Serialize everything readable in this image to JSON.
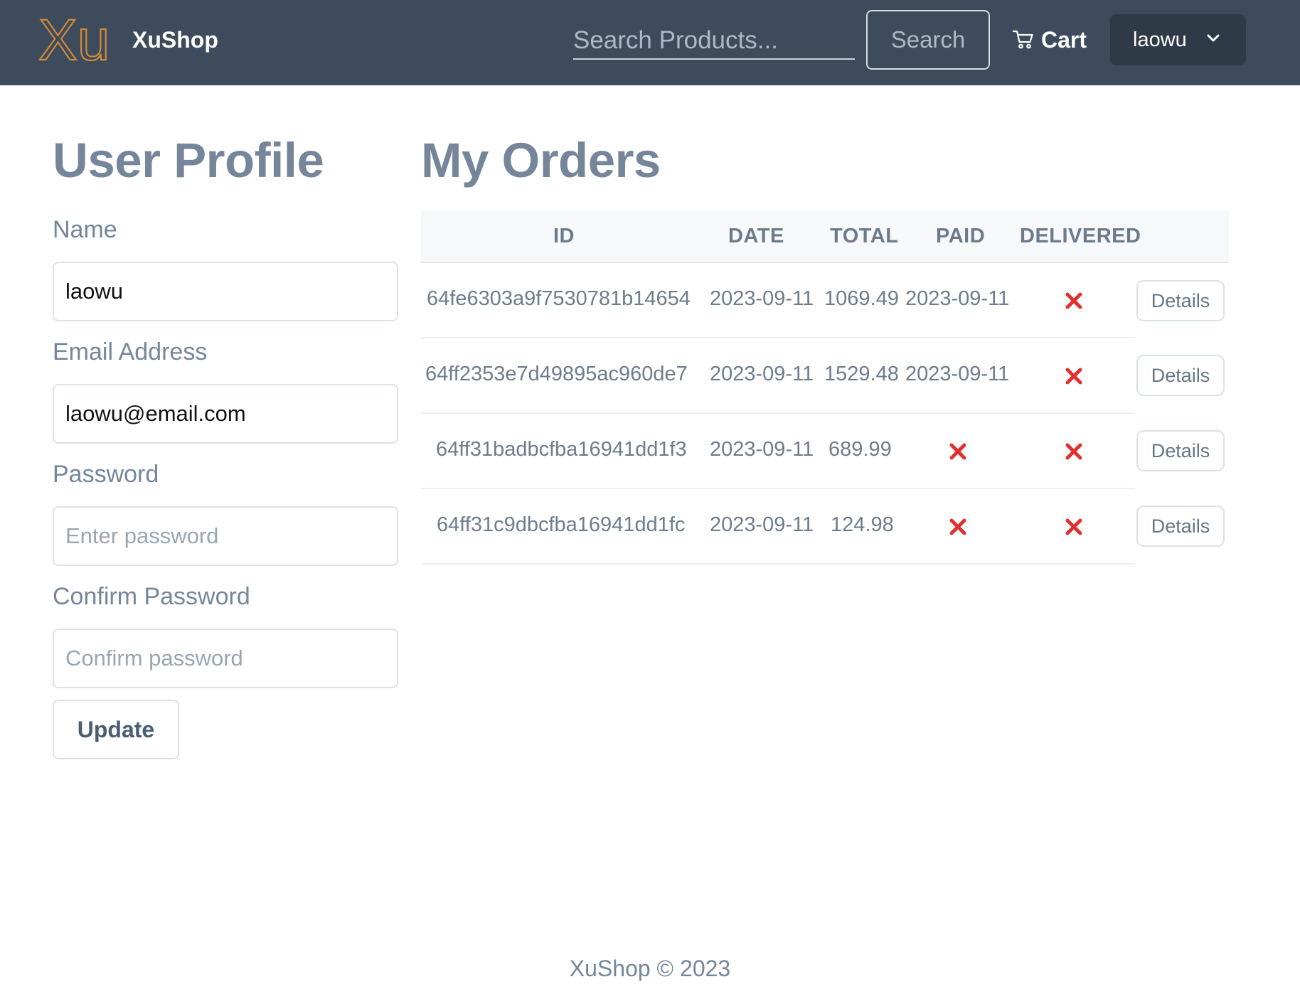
{
  "navbar": {
    "logo_text": "Xu",
    "brand": "XuShop",
    "search_placeholder": "Search Products...",
    "search_button": "Search",
    "cart_label": "Cart",
    "user_menu": "laowu"
  },
  "profile": {
    "title": "User Profile",
    "name_label": "Name",
    "name_value": "laowu",
    "email_label": "Email Address",
    "email_value": "laowu@email.com",
    "password_label": "Password",
    "password_placeholder": "Enter password",
    "confirm_label": "Confirm Password",
    "confirm_placeholder": "Confirm password",
    "update_button": "Update"
  },
  "orders": {
    "title": "My Orders",
    "columns": [
      "ID",
      "DATE",
      "TOTAL",
      "PAID",
      "DELIVERED"
    ],
    "rows": [
      {
        "id": "64fe6303a9f7530781b14654",
        "date": "2023-09-11",
        "total": "1069.49",
        "paid": "2023-09-11",
        "delivered": false,
        "action": "Details"
      },
      {
        "id": "64ff2353e7d49895ac960de7",
        "date": "2023-09-11",
        "total": "1529.48",
        "paid": "2023-09-11",
        "delivered": false,
        "action": "Details"
      },
      {
        "id": "64ff31badbcfba16941dd1f3",
        "date": "2023-09-11",
        "total": "689.99",
        "paid": false,
        "delivered": false,
        "action": "Details"
      },
      {
        "id": "64ff31c9dbcfba16941dd1fc",
        "date": "2023-09-11",
        "total": "124.98",
        "paid": false,
        "delivered": false,
        "action": "Details"
      }
    ]
  },
  "footer": "XuShop © 2023",
  "colors": {
    "navbar_bg": "#3d4b5c",
    "logo_accent": "#d08a3a",
    "x_mark": "#e2302e",
    "heading": "#75869a"
  },
  "icons": {
    "cart": "cart-icon",
    "dropdown": "chevron-down-icon",
    "not_done": "x-mark-icon"
  }
}
